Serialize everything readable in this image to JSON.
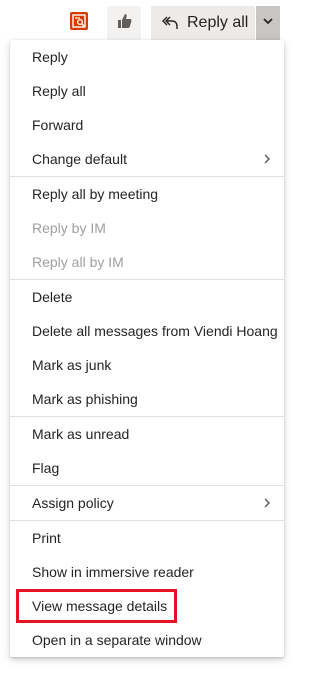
{
  "toolbar": {
    "immersive_icon": "immersive-reader-icon",
    "like_icon": "thumbs-up-icon",
    "reply_all_label": "Reply all",
    "reply_icon": "reply-all-arrow-icon",
    "dropdown_icon": "chevron-down-icon"
  },
  "menu": {
    "groups": [
      {
        "items": [
          {
            "label": "Reply"
          },
          {
            "label": "Reply all"
          },
          {
            "label": "Forward"
          },
          {
            "label": "Change default",
            "submenu": true
          }
        ]
      },
      {
        "items": [
          {
            "label": "Reply all by meeting"
          },
          {
            "label": "Reply by IM",
            "disabled": true
          },
          {
            "label": "Reply all by IM",
            "disabled": true
          }
        ]
      },
      {
        "items": [
          {
            "label": "Delete"
          },
          {
            "label": "Delete all messages from Viendi Hoang"
          },
          {
            "label": "Mark as junk"
          },
          {
            "label": "Mark as phishing"
          }
        ]
      },
      {
        "items": [
          {
            "label": "Mark as unread"
          },
          {
            "label": "Flag"
          }
        ]
      },
      {
        "items": [
          {
            "label": "Assign policy",
            "submenu": true
          }
        ]
      },
      {
        "items": [
          {
            "label": "Print"
          },
          {
            "label": "Show in immersive reader"
          },
          {
            "label": "View message details",
            "highlighted": true
          },
          {
            "label": "Open in a separate window"
          }
        ]
      }
    ]
  },
  "colors": {
    "highlight_border": "#e81123",
    "immersive_icon": "#d83b01",
    "disabled_text": "#a19f9d"
  }
}
